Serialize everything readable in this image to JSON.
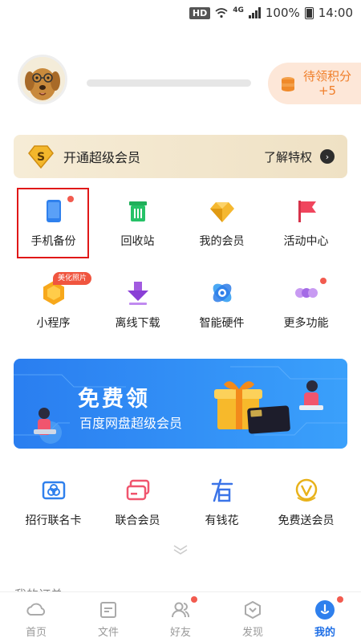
{
  "status_bar": {
    "hd": "HD",
    "network": "4G",
    "battery": "100%",
    "time": "14:00"
  },
  "profile": {
    "points_label": "待领积分",
    "points_value": "+5"
  },
  "vip": {
    "title": "开通超级会员",
    "link": "了解特权",
    "badge": "S"
  },
  "grid_row1": [
    {
      "label": "手机备份",
      "icon": "phone-icon",
      "dot": true,
      "selected": true
    },
    {
      "label": "回收站",
      "icon": "trash-icon"
    },
    {
      "label": "我的会员",
      "icon": "diamond-icon"
    },
    {
      "label": "活动中心",
      "icon": "flag-icon"
    }
  ],
  "grid_row2": [
    {
      "label": "小程序",
      "icon": "mini-program-icon",
      "tag": "美化照片"
    },
    {
      "label": "离线下载",
      "icon": "download-icon"
    },
    {
      "label": "智能硬件",
      "icon": "smart-hardware-icon"
    },
    {
      "label": "更多功能",
      "icon": "more-icon",
      "dot": true
    }
  ],
  "ad": {
    "title": "免费领",
    "subtitle": "百度网盘超级会员"
  },
  "grid_row3": [
    {
      "label": "招行联名卡",
      "icon": "card-icon"
    },
    {
      "label": "联合会员",
      "icon": "joint-member-icon"
    },
    {
      "label": "有钱花",
      "icon": "youqianhua-icon"
    },
    {
      "label": "免费送会员",
      "icon": "free-vip-icon"
    }
  ],
  "orders_label": "我的订单",
  "tabs": [
    {
      "label": "首页",
      "icon": "home-cloud-icon"
    },
    {
      "label": "文件",
      "icon": "folder-icon"
    },
    {
      "label": "好友",
      "icon": "friends-icon",
      "dot": true
    },
    {
      "label": "发现",
      "icon": "discover-icon"
    },
    {
      "label": "我的",
      "icon": "me-icon",
      "active": true,
      "dot": true
    }
  ],
  "colors": {
    "accent": "#1f6fe6",
    "points": "#f07f2a",
    "dot": "#f25b4f",
    "selection": "#e01818"
  }
}
